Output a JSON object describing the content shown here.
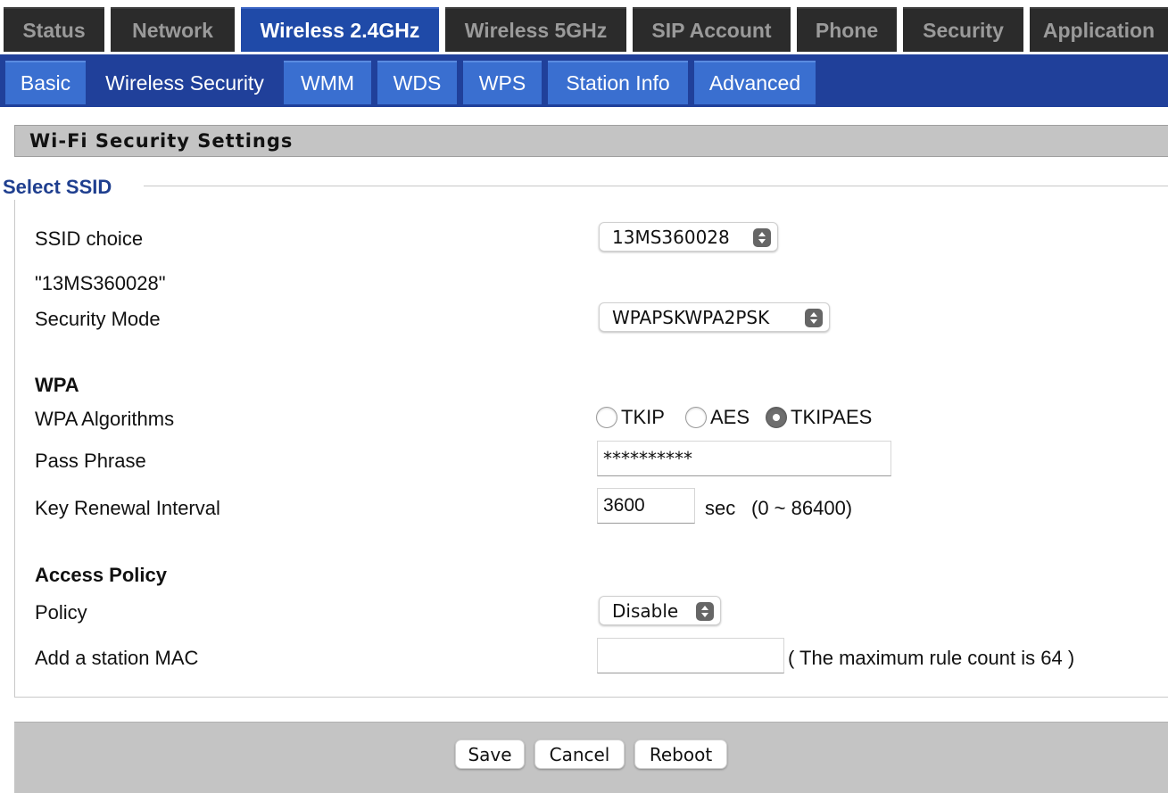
{
  "top_tabs": [
    "Status",
    "Network",
    "Wireless 2.4GHz",
    "Wireless 5GHz",
    "SIP Account",
    "Phone",
    "Security",
    "Application"
  ],
  "top_tab_active": "Wireless 2.4GHz",
  "sub_tabs": [
    "Basic",
    "Wireless Security",
    "WMM",
    "WDS",
    "WPS",
    "Station Info",
    "Advanced"
  ],
  "sub_tab_active": "Wireless Security",
  "section_title": "Wi-Fi Security Settings",
  "select_ssid": {
    "legend": "Select SSID",
    "ssid_choice_label": "SSID choice",
    "ssid_choice_value": "13MS360028",
    "ssid_quoted": "\"13MS360028\"",
    "security_mode_label": "Security Mode",
    "security_mode_value": "WPAPSKWPA2PSK"
  },
  "wpa": {
    "heading": "WPA",
    "algorithms_label": "WPA Algorithms",
    "algorithms": [
      {
        "label": "TKIP",
        "checked": false
      },
      {
        "label": "AES",
        "checked": false
      },
      {
        "label": "TKIPAES",
        "checked": true
      }
    ],
    "pass_phrase_label": "Pass Phrase",
    "pass_phrase_value": "**********",
    "key_renewal_label": "Key Renewal Interval",
    "key_renewal_value": "3600",
    "key_renewal_unit": "sec",
    "key_renewal_range": "(0 ~ 86400)"
  },
  "access_policy": {
    "heading": "Access Policy",
    "policy_label": "Policy",
    "policy_value": "Disable",
    "add_mac_label": "Add a station MAC",
    "add_mac_value": "",
    "max_rule_note": "( The maximum rule count is 64 )"
  },
  "buttons": {
    "save": "Save",
    "cancel": "Cancel",
    "reboot": "Reboot"
  }
}
